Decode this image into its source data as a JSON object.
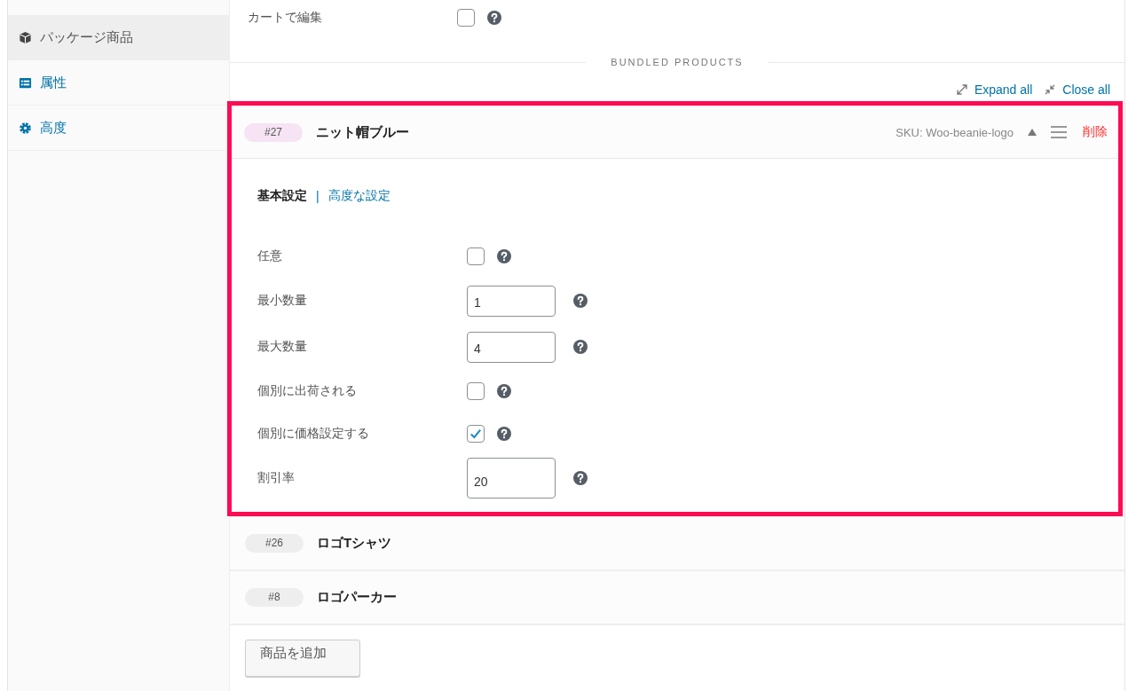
{
  "sidebar": {
    "items": [
      {
        "label": "パッケージ商品",
        "selected": true
      },
      {
        "label": "属性",
        "selected": false
      },
      {
        "label": "高度",
        "selected": false
      }
    ]
  },
  "top_field": {
    "label": "カートで編集",
    "checked": false
  },
  "section_title": "BUNDLED PRODUCTS",
  "links": [
    {
      "label": "Expand all",
      "kind": "expand"
    },
    {
      "label": "Close all",
      "kind": "collapse"
    }
  ],
  "bundled_items": [
    {
      "id": "#27",
      "name": "ニット帽ブルー",
      "expanded": true,
      "highlighted": true,
      "sku": "SKU: Woo-beanie-logo",
      "remove": "削除",
      "tab_separator": "|",
      "tabs": [
        {
          "label": "基本設定",
          "selected": true
        },
        {
          "label": "高度な設定",
          "selected": false
        }
      ],
      "fields": [
        {
          "kind": "checkbox",
          "label": "任意",
          "checked": false
        },
        {
          "kind": "number",
          "label": "最小数量",
          "value": "1"
        },
        {
          "kind": "number",
          "label": "最大数量",
          "value": "4"
        },
        {
          "kind": "checkbox",
          "label": "個別に出荷される",
          "checked": false
        },
        {
          "kind": "checkbox",
          "label": "個別に価格設定する",
          "checked": true
        },
        {
          "kind": "number",
          "label": "割引率",
          "value": "20"
        }
      ]
    },
    {
      "id": "#26",
      "name": "ロゴTシャツ",
      "expanded": false,
      "highlighted": false
    },
    {
      "id": "#8",
      "name": "ロゴパーカー",
      "expanded": false,
      "highlighted": false
    }
  ],
  "add_button": "商品を追加"
}
